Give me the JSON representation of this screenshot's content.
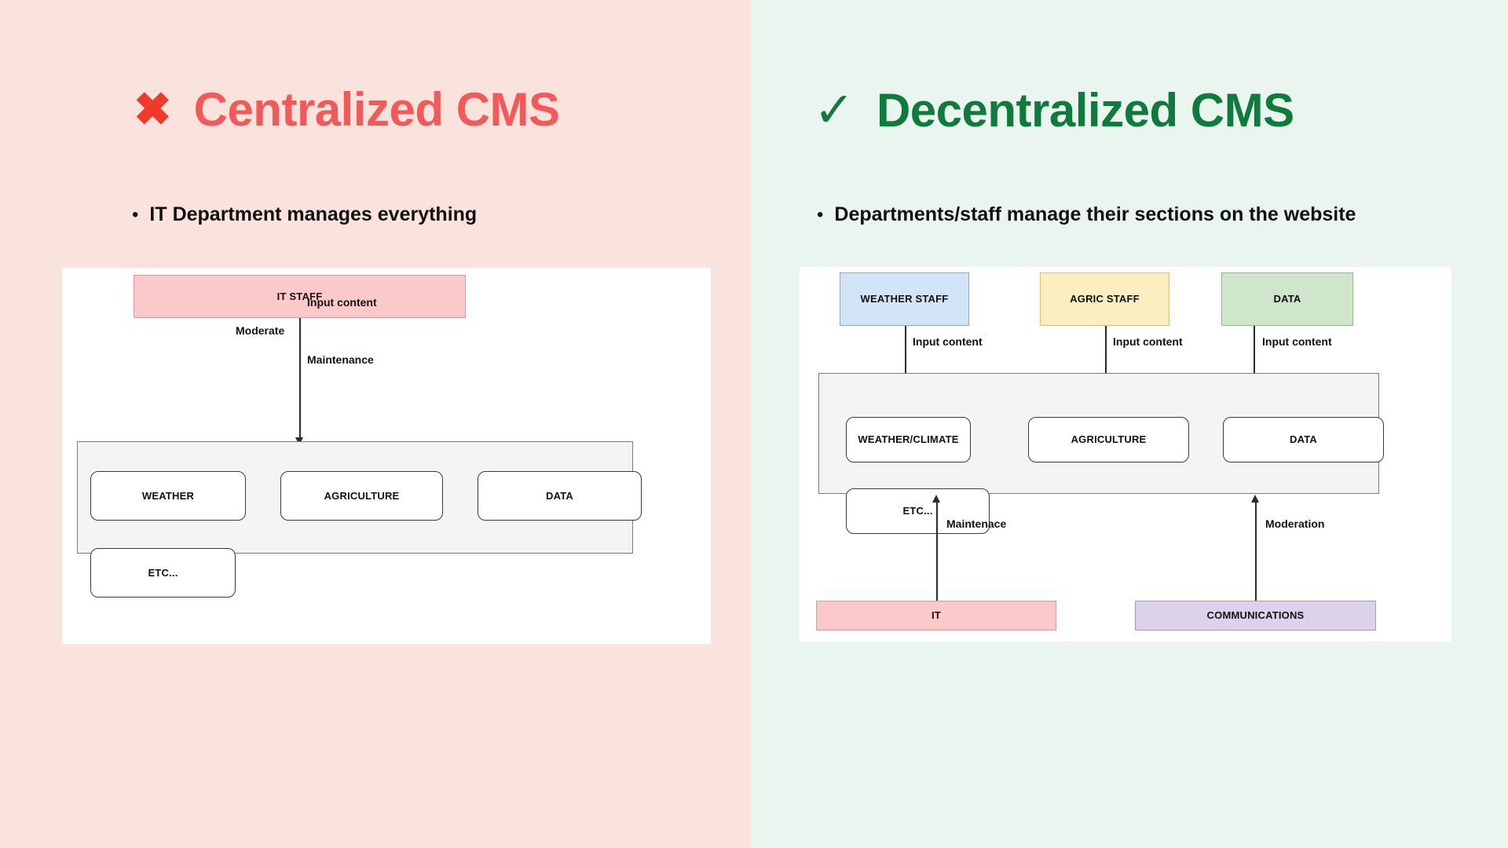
{
  "colors": {
    "left_panel_bg": "#fae2dd",
    "right_panel_bg": "#eaf5ef",
    "red_accent": "#f25a5a",
    "red_mark": "#f0392b",
    "green_accent": "#0e7a3c",
    "green_mark": "#117a3d",
    "card_bg": "#ffffff",
    "group_panel_bg": "#f4f4f4",
    "box_pink": "#fcc9ca",
    "box_blue": "#d3e3f8",
    "box_yellow": "#fdeec0",
    "box_green": "#cfe5cc",
    "box_purple": "#ddd2ec",
    "box_white": "#ffffff"
  },
  "left": {
    "mark_icon": "cross-mark-icon",
    "mark_glyph": "✖",
    "title": "Centralized CMS",
    "bullet_glyph": "•",
    "bullet": "IT Department manages everything",
    "diagram": {
      "top_box": "IT  STAFF",
      "edge_labels": {
        "input_content": "Input content",
        "moderate": "Moderate",
        "maintenance": "Maintenance"
      },
      "section_boxes": [
        "WEATHER",
        "AGRICULTURE",
        "DATA",
        "ETC..."
      ]
    }
  },
  "right": {
    "mark_icon": "check-mark-icon",
    "mark_glyph": "✓",
    "title": "Decentralized CMS",
    "bullet_glyph": "•",
    "bullet": "Departments/staff manage their sections on the website",
    "diagram": {
      "staff_boxes": [
        "WEATHER STAFF",
        "AGRIC STAFF",
        "DATA"
      ],
      "input_labels": [
        "Input content",
        "Input content",
        "Input content"
      ],
      "section_boxes": [
        "WEATHER/CLIMATE",
        "AGRICULTURE",
        "DATA",
        "ETC..."
      ],
      "support_boxes": [
        "IT",
        "COMMUNICATIONS"
      ],
      "support_labels": [
        "Maintenace",
        "Moderation"
      ]
    }
  }
}
